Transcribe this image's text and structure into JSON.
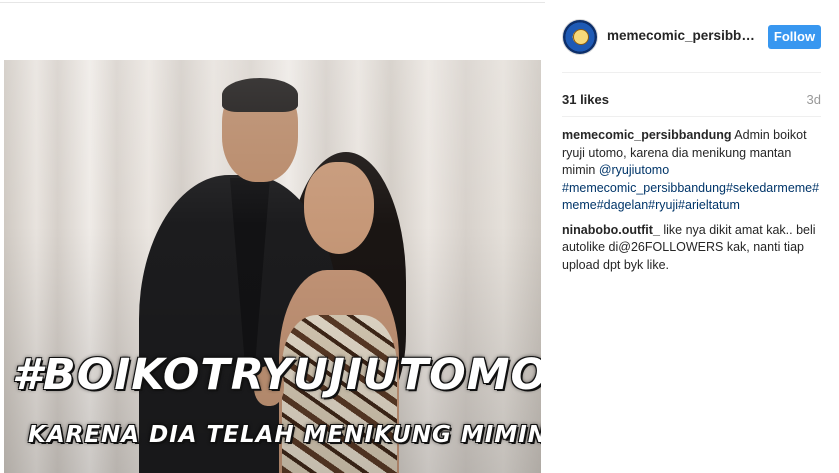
{
  "post": {
    "image_overlay": {
      "title": "#BOIKOTRYUJIUTOMO",
      "subtitle": "KARENA DIA TELAH MENIKUNG MIMIN"
    }
  },
  "header": {
    "username": "memecomic_persibban...",
    "follow_label": "Follow"
  },
  "stats": {
    "likes": "31 likes",
    "time": "3d"
  },
  "caption": {
    "username": "memecomic_persibbandung",
    "text": " Admin boikot ryuji utomo, karena dia menikung mantan mimin ",
    "mention": "@ryujiutomo",
    "hashtags": "#memecomic_persibbandung#sekedarmeme#meme#dagelan#ryuji#arieltatum"
  },
  "comments": [
    {
      "username": "ninabobo.outfit_",
      "text": " like nya dikit amat kak.. beli autolike di@26FOLLOWERS kak, nanti tiap upload dpt byk like."
    }
  ],
  "colors": {
    "follow_button": "#3897f0",
    "link": "#003569",
    "text": "#262626",
    "muted": "#999999"
  }
}
